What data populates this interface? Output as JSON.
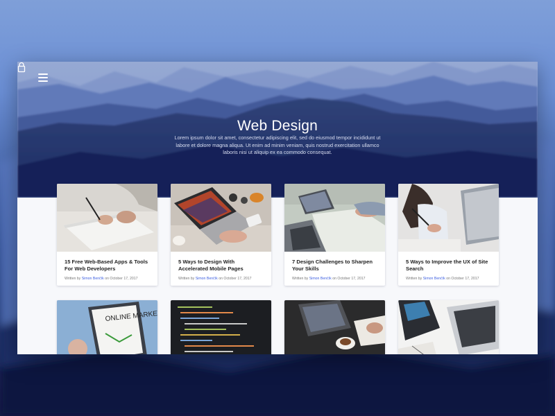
{
  "header": {
    "title": "Web Design",
    "description": "Lorem ipsum dolor sit amet, consectetur adipiscing elit, sed do eiusmod tempor incididunt ut labore et dolore magna aliqua. Ut enim ad minim veniam, quis nostrud exercitation ullamco laboris nisi ut aliquip ex ea commodo consequat."
  },
  "icons": {
    "menu": "hamburger-icon",
    "cart": "shopping-bag-icon"
  },
  "colors": {
    "author_link": "#3d5fe0",
    "hero_dark": "#1a2a63"
  },
  "posts": [
    {
      "title": "15 Free Web-Based Apps & Tools For Web Developers",
      "written_by": "Written by",
      "author": "Simon Benčík",
      "on": "on",
      "date": "October 17, 2017"
    },
    {
      "title": "5 Ways to Design With Accelerated Mobile Pages",
      "written_by": "Written by",
      "author": "Simon Benčík",
      "on": "on",
      "date": "October 17, 2017"
    },
    {
      "title": "7 Design Challenges to Sharpen Your Skills",
      "written_by": "Written by",
      "author": "Simon Benčík",
      "on": "on",
      "date": "October 17, 2017"
    },
    {
      "title": "5 Ways to Improve the UX of Site Search",
      "written_by": "Written by",
      "author": "Simon Benčík",
      "on": "on",
      "date": "October 17, 2017"
    }
  ],
  "second_row_images": {
    "online_marketing_text": "ONLINE MARKETING"
  }
}
